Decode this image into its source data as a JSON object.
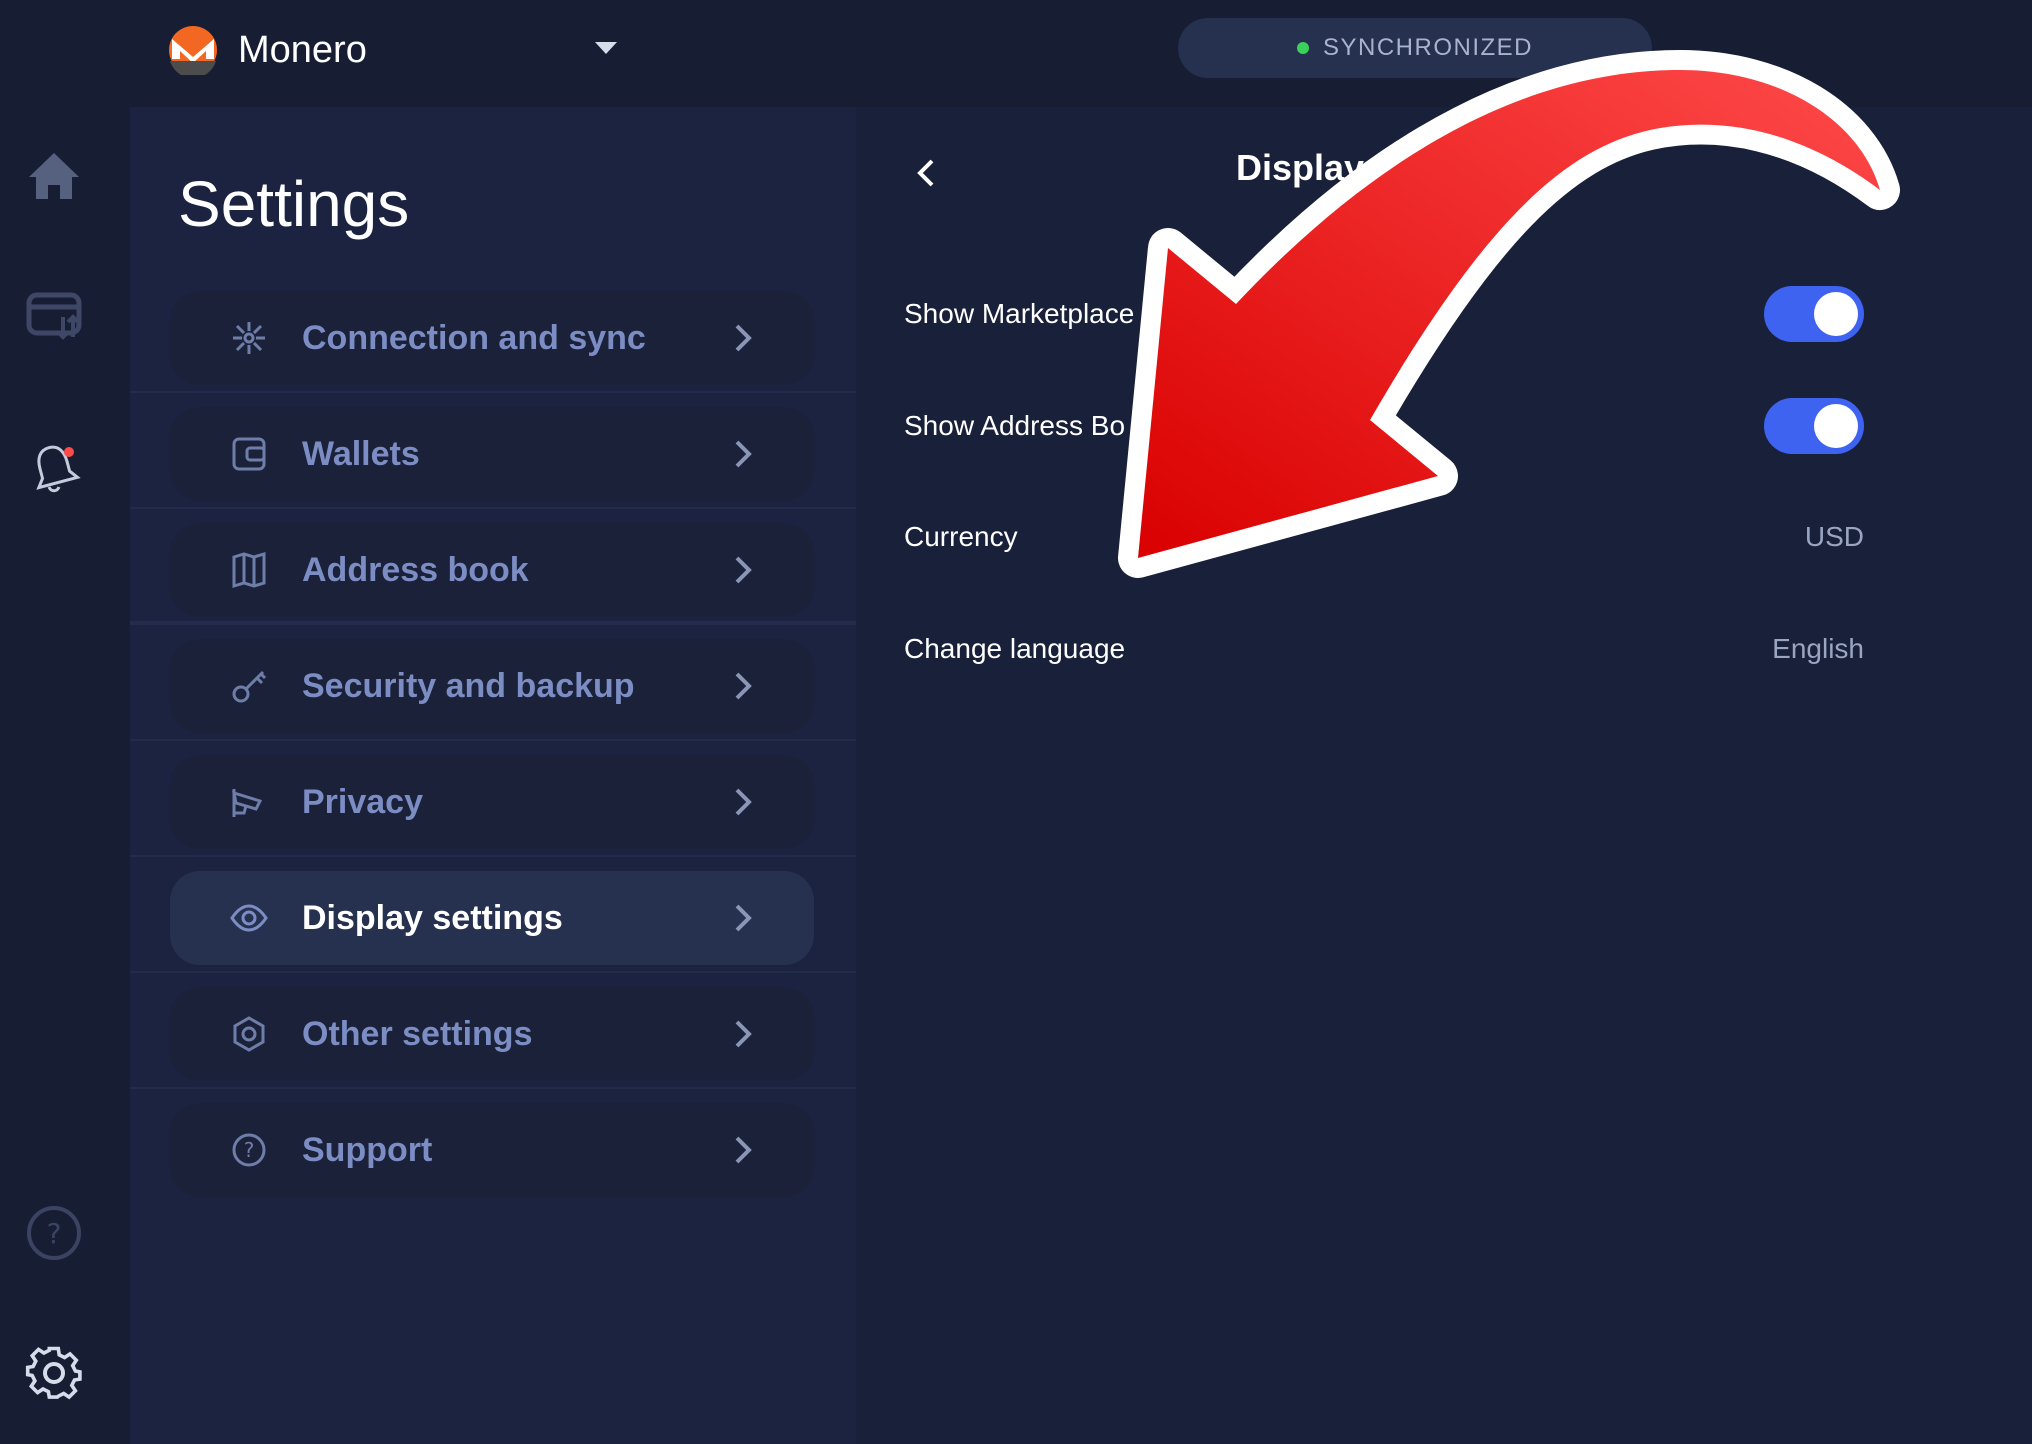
{
  "header": {
    "wallet_name": "Monero",
    "sync_status": "SYNCHRONIZED",
    "sync_color": "#3ad15a"
  },
  "rail": {
    "icons": [
      "home-icon",
      "transactions-icon",
      "notifications-icon",
      "help-icon",
      "settings-gear-icon"
    ]
  },
  "settings": {
    "title": "Settings",
    "items": [
      {
        "label": "Connection and sync",
        "icon": "network-icon"
      },
      {
        "label": "Wallets",
        "icon": "wallet-icon"
      },
      {
        "label": "Address book",
        "icon": "book-icon"
      },
      {
        "label": "Security and backup",
        "icon": "key-icon"
      },
      {
        "label": "Privacy",
        "icon": "camera-icon"
      },
      {
        "label": "Display settings",
        "icon": "eye-icon",
        "active": true
      },
      {
        "label": "Other settings",
        "icon": "hexagon-icon"
      },
      {
        "label": "Support",
        "icon": "help-circle-icon"
      }
    ]
  },
  "display": {
    "title": "Display",
    "options": [
      {
        "label": "Show Marketplace",
        "type": "toggle",
        "on": true
      },
      {
        "label": "Show Address Bo",
        "type": "toggle",
        "on": true
      },
      {
        "label": "Currency",
        "type": "value",
        "value": "USD"
      },
      {
        "label": "Change language",
        "type": "value",
        "value": "English"
      }
    ]
  },
  "colors": {
    "accent": "#3e63f0",
    "annotation_arrow": "#e8191b",
    "notification_dot": "#ff4a4a"
  }
}
